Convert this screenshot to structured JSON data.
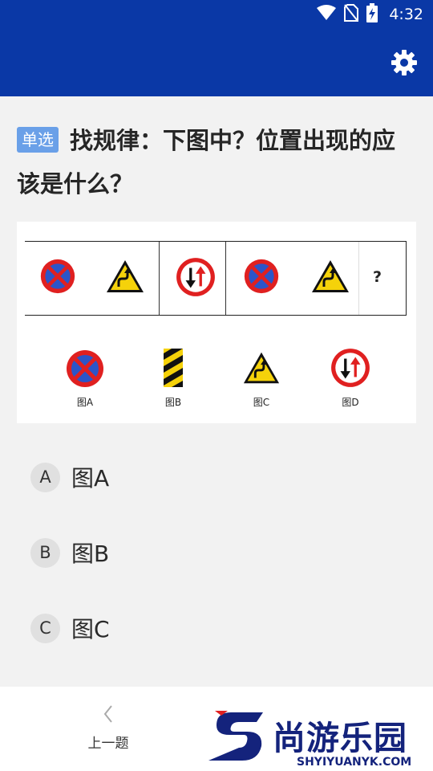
{
  "status_bar": {
    "time": "4:32",
    "icons": [
      "wifi-icon",
      "no-sim-icon",
      "battery-charging-icon"
    ]
  },
  "app_bar": {
    "settings_icon": "gear-icon"
  },
  "question": {
    "type_badge": "单选",
    "text": "找规律：下图中？位置出现的应该是什么？"
  },
  "figure": {
    "sequence": [
      "no-parking-sign",
      "winding-road-sign",
      "two-way-traffic-sign",
      "no-parking-sign",
      "winding-road-sign"
    ],
    "missing_mark": "?",
    "candidates": [
      {
        "label": "图A",
        "sign": "no-parking-sign"
      },
      {
        "label": "图B",
        "sign": "hazard-post-sign"
      },
      {
        "label": "图C",
        "sign": "winding-road-sign"
      },
      {
        "label": "图D",
        "sign": "two-way-traffic-sign"
      }
    ]
  },
  "options": [
    {
      "letter": "A",
      "text": "图A"
    },
    {
      "letter": "B",
      "text": "图B"
    },
    {
      "letter": "C",
      "text": "图C"
    }
  ],
  "bottom_bar": {
    "prev_label": "上一题",
    "prev_icon": "chevron-left-icon"
  },
  "watermark": {
    "text": "尚游乐园",
    "url": "SHYIYUANYK.COM"
  },
  "colors": {
    "primary": "#0a38a6",
    "badge": "#6aa0e8",
    "sign_red": "#e02020",
    "sign_blue": "#2c55c8",
    "sign_yellow": "#f5d20a"
  }
}
